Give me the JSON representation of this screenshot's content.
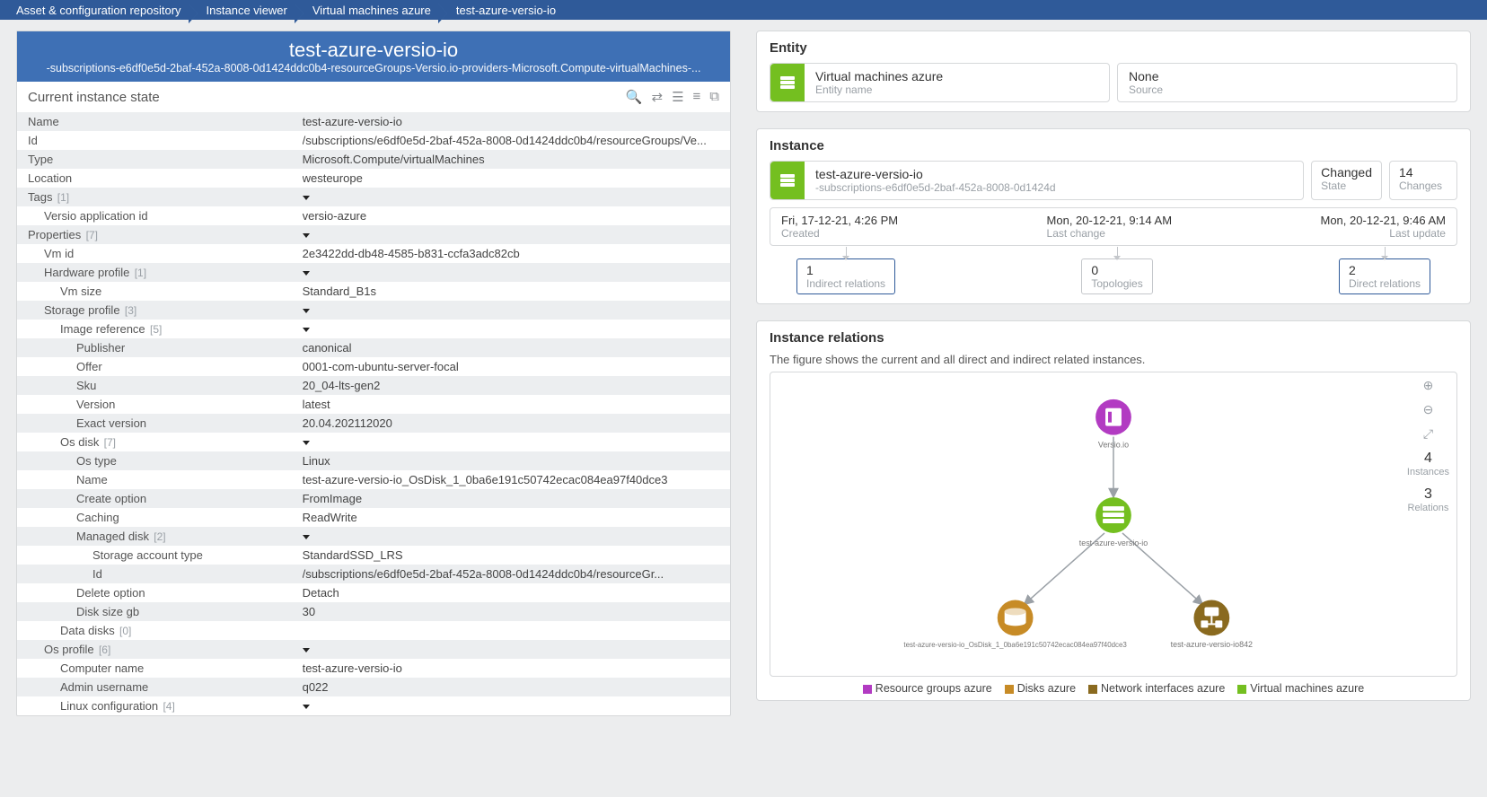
{
  "breadcrumb": [
    "Asset & configuration repository",
    "Instance viewer",
    "Virtual machines azure",
    "test-azure-versio-io"
  ],
  "title": {
    "main": "test-azure-versio-io",
    "sub": "-subscriptions-e6df0e5d-2baf-452a-8008-0d1424ddc0b4-resourceGroups-Versio.io-providers-Microsoft.Compute-virtualMachines-..."
  },
  "state_title": "Current instance state",
  "props": [
    {
      "k": "Name",
      "v": "test-azure-versio-io",
      "alt": 1,
      "ind": 0
    },
    {
      "k": "Id",
      "v": "/subscriptions/e6df0e5d-2baf-452a-8008-0d1424ddc0b4/resourceGroups/Ve...",
      "alt": 0,
      "ind": 0
    },
    {
      "k": "Type",
      "v": "Microsoft.Compute/virtualMachines",
      "alt": 1,
      "ind": 0
    },
    {
      "k": "Location",
      "v": "westeurope",
      "alt": 0,
      "ind": 0
    },
    {
      "k": "Tags",
      "cnt": "[1]",
      "v": "",
      "chev": 1,
      "alt": 1,
      "ind": 0
    },
    {
      "k": "Versio application id",
      "v": "versio-azure",
      "alt": 0,
      "ind": 1
    },
    {
      "k": "Properties",
      "cnt": "[7]",
      "v": "",
      "chev": 1,
      "alt": 1,
      "ind": 0
    },
    {
      "k": "Vm id",
      "v": "2e3422dd-db48-4585-b831-ccfa3adc82cb",
      "alt": 0,
      "ind": 1
    },
    {
      "k": "Hardware profile",
      "cnt": "[1]",
      "v": "",
      "chev": 1,
      "alt": 1,
      "ind": 1
    },
    {
      "k": "Vm size",
      "v": "Standard_B1s",
      "alt": 0,
      "ind": 2
    },
    {
      "k": "Storage profile",
      "cnt": "[3]",
      "v": "",
      "chev": 1,
      "alt": 1,
      "ind": 1
    },
    {
      "k": "Image reference",
      "cnt": "[5]",
      "v": "",
      "chev": 1,
      "alt": 0,
      "ind": 2
    },
    {
      "k": "Publisher",
      "v": "canonical",
      "alt": 1,
      "ind": 3
    },
    {
      "k": "Offer",
      "v": "0001-com-ubuntu-server-focal",
      "alt": 0,
      "ind": 3
    },
    {
      "k": "Sku",
      "v": "20_04-lts-gen2",
      "alt": 1,
      "ind": 3
    },
    {
      "k": "Version",
      "v": "latest",
      "alt": 0,
      "ind": 3
    },
    {
      "k": "Exact version",
      "v": "20.04.202112020",
      "alt": 1,
      "ind": 3
    },
    {
      "k": "Os disk",
      "cnt": "[7]",
      "v": "",
      "chev": 1,
      "alt": 0,
      "ind": 2
    },
    {
      "k": "Os type",
      "v": "Linux",
      "alt": 1,
      "ind": 3
    },
    {
      "k": "Name",
      "v": "test-azure-versio-io_OsDisk_1_0ba6e191c50742ecac084ea97f40dce3",
      "alt": 0,
      "ind": 3
    },
    {
      "k": "Create option",
      "v": "FromImage",
      "alt": 1,
      "ind": 3
    },
    {
      "k": "Caching",
      "v": "ReadWrite",
      "alt": 0,
      "ind": 3
    },
    {
      "k": "Managed disk",
      "cnt": "[2]",
      "v": "",
      "chev": 1,
      "alt": 1,
      "ind": 3
    },
    {
      "k": "Storage account type",
      "v": "StandardSSD_LRS",
      "alt": 0,
      "ind": 4
    },
    {
      "k": "Id",
      "v": "/subscriptions/e6df0e5d-2baf-452a-8008-0d1424ddc0b4/resourceGr...",
      "alt": 1,
      "ind": 4
    },
    {
      "k": "Delete option",
      "v": "Detach",
      "alt": 0,
      "ind": 3
    },
    {
      "k": "Disk size gb",
      "v": "30",
      "alt": 1,
      "ind": 3
    },
    {
      "k": "Data disks",
      "cnt": "[0]",
      "v": "",
      "alt": 0,
      "ind": 2
    },
    {
      "k": "Os profile",
      "cnt": "[6]",
      "v": "",
      "chev": 1,
      "alt": 1,
      "ind": 1
    },
    {
      "k": "Computer name",
      "v": "test-azure-versio-io",
      "alt": 0,
      "ind": 2
    },
    {
      "k": "Admin username",
      "v": "q022",
      "alt": 1,
      "ind": 2
    },
    {
      "k": "Linux configuration",
      "cnt": "[4]",
      "v": "",
      "chev": 1,
      "alt": 0,
      "ind": 2
    }
  ],
  "entity": {
    "title": "Entity",
    "name": "Virtual machines azure",
    "name_label": "Entity name",
    "source": "None",
    "source_label": "Source"
  },
  "instance": {
    "title": "Instance",
    "name": "test-azure-versio-io",
    "sub": "-subscriptions-e6df0e5d-2baf-452a-8008-0d1424d",
    "state": "Changed",
    "state_label": "State",
    "changes": "14",
    "changes_label": "Changes",
    "created": "Fri, 17-12-21, 4:26 PM",
    "created_label": "Created",
    "last_change": "Mon, 20-12-21, 9:14 AM",
    "last_change_label": "Last change",
    "last_update": "Mon, 20-12-21, 9:46 AM",
    "last_update_label": "Last update",
    "indirect": "1",
    "indirect_label": "Indirect relations",
    "topologies": "0",
    "topologies_label": "Topologies",
    "direct": "2",
    "direct_label": "Direct relations"
  },
  "relations": {
    "title": "Instance relations",
    "desc": "The figure shows the current and all direct and indirect related instances.",
    "instances": "4",
    "instances_label": "Instances",
    "rel_count": "3",
    "rel_label": "Relations",
    "nodes": {
      "top": "Versio.io",
      "mid": "test-azure-versio-io",
      "left": "test-azure-versio-io_OsDisk_1_0ba6e191c50742ecac084ea97f40dce3",
      "right": "test-azure-versio-io842"
    },
    "legend": [
      {
        "c": "#b23bc2",
        "l": "Resource groups azure"
      },
      {
        "c": "#c78b26",
        "l": "Disks azure"
      },
      {
        "c": "#8a6a1f",
        "l": "Network interfaces azure"
      },
      {
        "c": "#74bf20",
        "l": "Virtual machines azure"
      }
    ]
  }
}
